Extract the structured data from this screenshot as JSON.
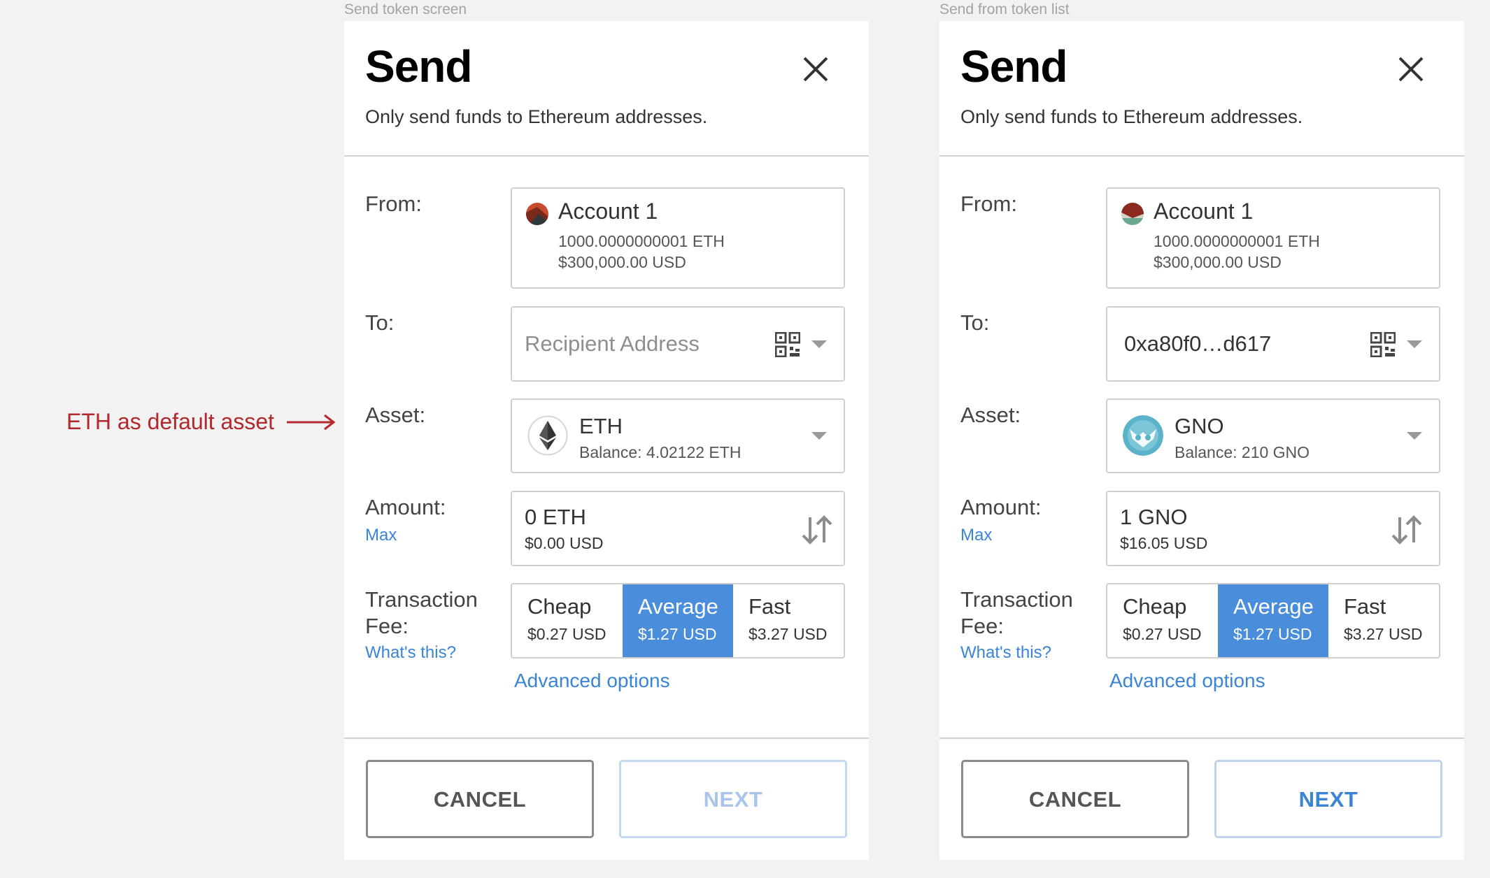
{
  "annotation": {
    "text": "ETH as default asset"
  },
  "panels": [
    {
      "caption": "Send token screen",
      "title": "Send",
      "subtitle": "Only send funds to Ethereum addresses.",
      "from_label": "From:",
      "account": {
        "name": "Account 1",
        "balance": "1000.0000000001 ETH",
        "usd": "$300,000.00 USD"
      },
      "to_label": "To:",
      "to_value": "Recipient Address",
      "asset_label": "Asset:",
      "asset": {
        "name": "ETH",
        "balance": "Balance: 4.02122 ETH",
        "icon": "ethereum-icon"
      },
      "amount_label": "Amount:",
      "max_link": "Max",
      "amount": {
        "value": "0 ETH",
        "usd": "$0.00 USD"
      },
      "fee_label_1": "Transaction",
      "fee_label_2": "Fee:",
      "whats_this": "What's this?",
      "fees": [
        {
          "name": "Cheap",
          "price": "$0.27 USD"
        },
        {
          "name": "Average",
          "price": "$1.27 USD"
        },
        {
          "name": "Fast",
          "price": "$3.27 USD"
        }
      ],
      "selected_fee": "Average",
      "advanced": "Advanced options",
      "cancel": "CANCEL",
      "next": "NEXT",
      "next_enabled": false
    },
    {
      "caption": "Send from token list",
      "title": "Send",
      "subtitle": "Only send funds to Ethereum addresses.",
      "from_label": "From:",
      "account": {
        "name": "Account 1",
        "balance": "1000.0000000001 ETH",
        "usd": "$300,000.00 USD"
      },
      "to_label": "To:",
      "to_value": "0xa80f0…d617",
      "asset_label": "Asset:",
      "asset": {
        "name": "GNO",
        "balance": "Balance: 210 GNO",
        "icon": "gnosis-icon"
      },
      "amount_label": "Amount:",
      "max_link": "Max",
      "amount": {
        "value": "1 GNO",
        "usd": "$16.05  USD"
      },
      "fee_label_1": "Transaction",
      "fee_label_2": "Fee:",
      "whats_this": "What's this?",
      "fees": [
        {
          "name": "Cheap",
          "price": "$0.27 USD"
        },
        {
          "name": "Average",
          "price": "$1.27 USD"
        },
        {
          "name": "Fast",
          "price": "$3.27 USD"
        }
      ],
      "selected_fee": "Average",
      "advanced": "Advanced options",
      "cancel": "CANCEL",
      "next": "NEXT",
      "next_enabled": true
    }
  ],
  "colors": {
    "accent": "#4a8ddb",
    "link": "#3a84d6",
    "annotation": "#b3282d",
    "background": "#f2f2f2"
  }
}
